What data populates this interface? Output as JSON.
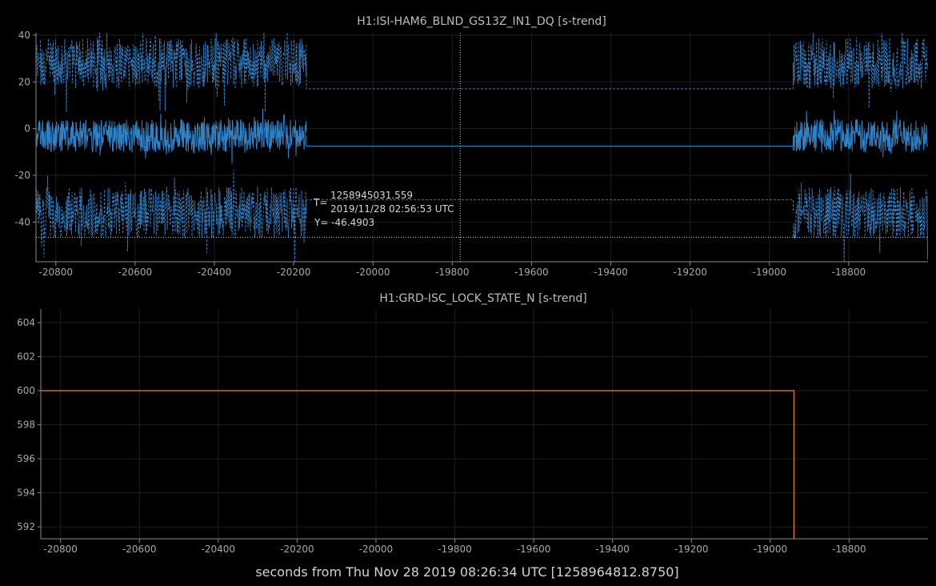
{
  "window": {
    "xlabel": "seconds from Thu Nov 28 2019 08:26:34 UTC [1258964812.8750]"
  },
  "chart_data": [
    {
      "type": "line",
      "title": "H1:ISI-HAM6_BLND_GS13Z_IN1_DQ [s-trend]",
      "xlim": [
        -20850,
        -18600
      ],
      "ylim": [
        -57,
        41
      ],
      "xticks": [
        -20800,
        -20600,
        -20400,
        -20200,
        -20000,
        -19800,
        -19600,
        -19400,
        -19200,
        -19000,
        -18800
      ],
      "yticks": [
        40,
        20,
        0,
        -20,
        -40
      ],
      "grid": true,
      "color": "#2f82c8",
      "gap": [
        -20168,
        -18940
      ],
      "series": [
        {
          "role": "max",
          "style": "dashed",
          "band_center": 28,
          "band_half_width": 11,
          "spike": 13,
          "flat_value": 17
        },
        {
          "role": "mean",
          "style": "solid",
          "band_center": -3,
          "band_half_width": 7,
          "spike": 6,
          "flat_value": -7.5
        },
        {
          "role": "min",
          "style": "dashed",
          "band_center": -36,
          "band_half_width": 11,
          "spike": 14,
          "flat_value": -30.5
        }
      ],
      "cursor": {
        "x": -19780,
        "y": -46.4903,
        "t_label": "T=",
        "t_gps": "1258945031.559",
        "t_utc": "2019/11/28 02:56:53 UTC",
        "y_text": "Y= -46.4903"
      }
    },
    {
      "type": "line",
      "title": "H1:GRD-ISC_LOCK_STATE_N [s-trend]",
      "xlim": [
        -20850,
        -18600
      ],
      "ylim": [
        591.3,
        604.8
      ],
      "xticks": [
        -20800,
        -20600,
        -20400,
        -20200,
        -20000,
        -19800,
        -19600,
        -19400,
        -19200,
        -19000,
        -18800
      ],
      "yticks": [
        604,
        602,
        600,
        598,
        596,
        594,
        592
      ],
      "grid": true,
      "color": "#e8812f",
      "series": [
        {
          "x": [
            -20850,
            -18940,
            -18940
          ],
          "y": [
            600,
            600,
            591.3
          ]
        }
      ]
    }
  ]
}
